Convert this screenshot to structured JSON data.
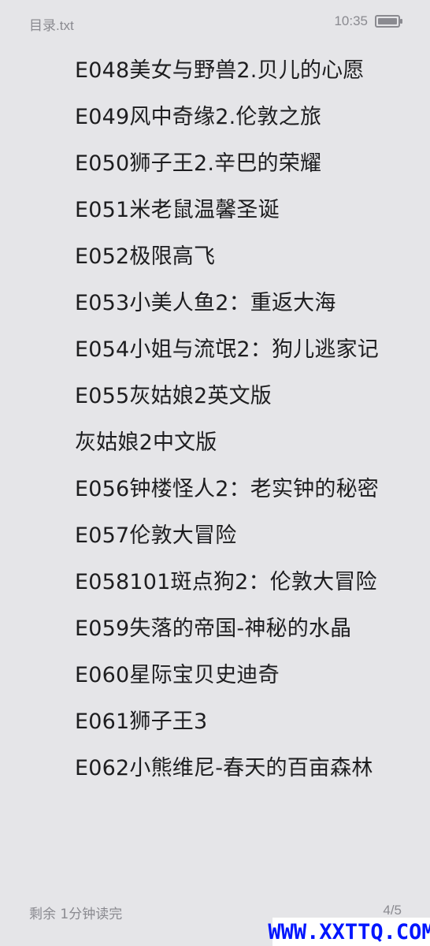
{
  "status_bar": {
    "title": "目录.txt",
    "time": "10:35",
    "battery_icon": "battery-icon"
  },
  "content": {
    "lines": [
      "E048美女与野兽2.贝儿的心愿",
      "E049风中奇缘2.伦敦之旅",
      "E050狮子王2.辛巴的荣耀",
      "E051米老鼠温馨圣诞",
      "E052极限高飞",
      "E053小美人鱼2：重返大海",
      "E054小姐与流氓2：狗儿逃家记",
      "E055灰姑娘2英文版",
      "灰姑娘2中文版",
      "E056钟楼怪人2：老实钟的秘密",
      "E057伦敦大冒险",
      "E058101斑点狗2：伦敦大冒险",
      "E059失落的帝国-神秘的水晶",
      "E060星际宝贝史迪奇",
      "E061狮子王3",
      "E062小熊维尼-春天的百亩森林"
    ]
  },
  "footer": {
    "remaining": "剩余 1分钟读完",
    "page": "4/5"
  },
  "watermark": {
    "text": "WWW.XXTTQ.COM",
    "color": "#0015ff"
  },
  "colors": {
    "background": "#e5e5e8",
    "text": "#1d1d1f",
    "muted": "#8a8a90"
  }
}
